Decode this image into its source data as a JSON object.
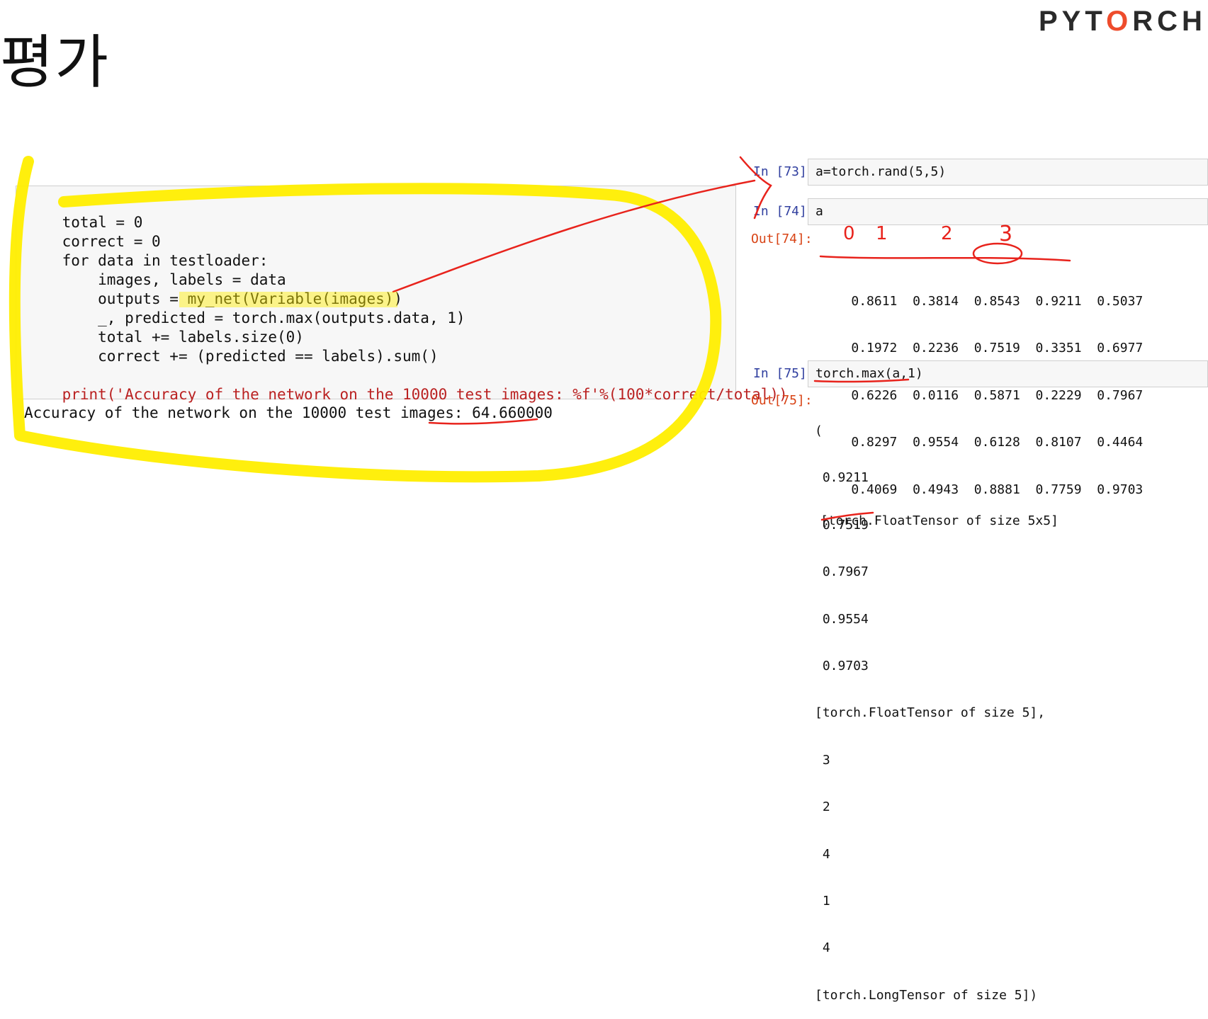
{
  "slide": {
    "title": "평가"
  },
  "logo": {
    "text": "PYTORCH",
    "color": "#ee4c2c"
  },
  "left_cell": {
    "lines": [
      "total = 0",
      "correct = 0",
      "for data in testloader:",
      "    images, labels = data",
      "    outputs = my_net(Variable(images))",
      "    _, predicted = torch.max(outputs.data, 1)",
      "    total += labels.size(0)",
      "    correct += (predicted == labels).sum()",
      "",
      "print('Accuracy of the network on the 10000 test images: %f'%(100*correct/total))"
    ],
    "output": "Accuracy of the network on the 10000 test images: 64.660000"
  },
  "right_cells": {
    "cell73": {
      "prompt": "In [73]:",
      "code": "a=torch.rand(5,5)"
    },
    "cell74": {
      "prompt": "In [74]:",
      "code": "a",
      "out_prompt": "Out[74]:",
      "rows": [
        [
          "0.8611",
          "0.3814",
          "0.8543",
          "0.9211",
          "0.5037"
        ],
        [
          "0.1972",
          "0.2236",
          "0.7519",
          "0.3351",
          "0.6977"
        ],
        [
          "0.6226",
          "0.0116",
          "0.5871",
          "0.2229",
          "0.7967"
        ],
        [
          "0.8297",
          "0.9554",
          "0.6128",
          "0.8107",
          "0.4464"
        ],
        [
          "0.4069",
          "0.4943",
          "0.8881",
          "0.7759",
          "0.9703"
        ]
      ],
      "footer": "[torch.FloatTensor of size 5x5]"
    },
    "cell75": {
      "prompt": "In [75]:",
      "code": "torch.max(a,1)",
      "out_prompt": "Out[75]:",
      "lines": [
        "(",
        " 0.9211",
        " 0.7519",
        " 0.7967",
        " 0.9554",
        " 0.9703",
        "[torch.FloatTensor of size 5],",
        " 3",
        " 2",
        " 4",
        " 1",
        " 4",
        "[torch.LongTensor of size 5])"
      ]
    }
  },
  "annotations": {
    "highlight_color": "#ffee00",
    "pen_color": "#e8231c",
    "column_marks": [
      "0",
      "1",
      "2",
      "3"
    ]
  }
}
